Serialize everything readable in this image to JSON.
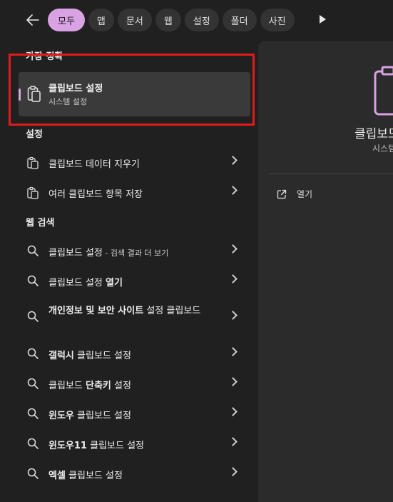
{
  "tabs": [
    "모두",
    "앱",
    "문서",
    "웹",
    "설정",
    "폴더",
    "사진"
  ],
  "best_match": {
    "section": "가장 정확",
    "title": "클립보드 설정",
    "subtitle": "시스템 설정"
  },
  "settings": {
    "section": "설정",
    "items": [
      "클립보드 데이터 지우기",
      "여러 클립보드 항목 저장"
    ]
  },
  "web_search": {
    "section": "웹 검색",
    "items": [
      {
        "pre": "클립보드 설정",
        "bold": "",
        "suffix": " - 검색 결과 더 보기"
      },
      {
        "pre": "클립보드 설정 ",
        "bold": "열기",
        "suffix": ""
      },
      {
        "pre": "",
        "bold": "개인정보 및 보안 사이트",
        "post": " 설정 클립보드",
        "suffix": ""
      },
      {
        "pre": "",
        "bold": "갤럭시",
        "post": " 클립보드 설정",
        "suffix": ""
      },
      {
        "pre": "클립보드 ",
        "bold": "단축키",
        "post": " 설정",
        "suffix": ""
      },
      {
        "pre": "",
        "bold": "윈도우",
        "post": " 클립보드 설정",
        "suffix": ""
      },
      {
        "pre": "",
        "bold": "윈도우11",
        "post": " 클립보드 설정",
        "suffix": ""
      },
      {
        "pre": "",
        "bold": "엑셀",
        "post": " 클립보드 설정",
        "suffix": ""
      }
    ]
  },
  "preview": {
    "title": "클립보드",
    "subtitle": "시스템",
    "open_label": "열기"
  },
  "icons": {
    "back": "back-arrow-icon",
    "more": "play-more-icon",
    "clipboard": "clipboard-icon",
    "search": "search-icon",
    "chevron": "chevron-right-icon",
    "open": "open-external-icon"
  },
  "colors": {
    "accent": "#d9a2e3",
    "highlight_box": "#e01b1b",
    "background": "#202020",
    "panel": "#2b2b2b"
  }
}
